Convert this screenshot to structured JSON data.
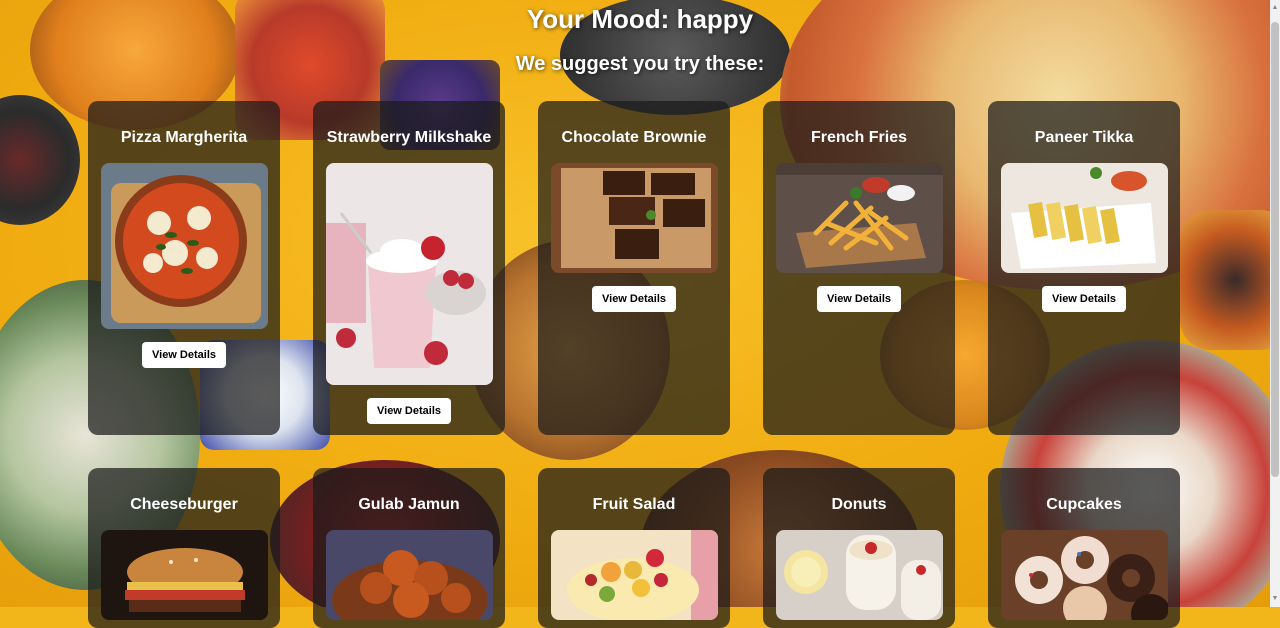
{
  "header": {
    "mood_title": "Your Mood: happy",
    "subtitle": "We suggest you try these:"
  },
  "foods": [
    {
      "name": "Pizza Margherita",
      "button": "View Details",
      "image": "pizza-image",
      "colors": [
        "#c8612a",
        "#e9c49a",
        "#8a3b1a"
      ]
    },
    {
      "name": "Strawberry Milkshake",
      "button": "View Details",
      "image": "milkshake-image",
      "colors": [
        "#f3e5e8",
        "#e7a7b3",
        "#c02a3a"
      ]
    },
    {
      "name": "Chocolate Brownie",
      "button": "View Details",
      "image": "brownie-image",
      "colors": [
        "#b9865a",
        "#4a2716",
        "#2a150c"
      ]
    },
    {
      "name": "French Fries",
      "button": "View Details",
      "image": "fries-image",
      "colors": [
        "#6a5a4a",
        "#e8a83a",
        "#c23a2a"
      ]
    },
    {
      "name": "Paneer Tikka",
      "button": "View Details",
      "image": "paneer-image",
      "colors": [
        "#f2f2f2",
        "#e9c04a",
        "#d86a2a"
      ]
    },
    {
      "name": "Cheeseburger",
      "button": "",
      "image": "burger-image",
      "colors": [
        "#2a1a12",
        "#c87a3a",
        "#e8c04a"
      ]
    },
    {
      "name": "Gulab Jamun",
      "button": "",
      "image": "gulab-jamun-image",
      "colors": [
        "#4a4a6a",
        "#c0581e",
        "#e88a3a"
      ]
    },
    {
      "name": "Fruit Salad",
      "button": "",
      "image": "fruit-salad-image",
      "colors": [
        "#f6e6c8",
        "#f2b43a",
        "#d2283a"
      ]
    },
    {
      "name": "Donuts",
      "button": "",
      "image": "donuts-image",
      "colors": [
        "#e6e2dc",
        "#f6e8a8",
        "#c8282a"
      ]
    },
    {
      "name": "Cupcakes",
      "button": "",
      "image": "cupcakes-image",
      "colors": [
        "#8a5a3a",
        "#f2e2d6",
        "#4a2a1a"
      ]
    }
  ]
}
